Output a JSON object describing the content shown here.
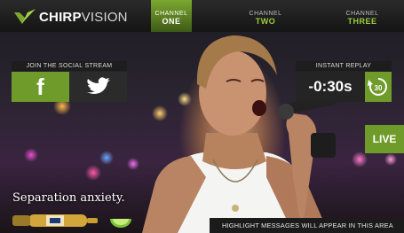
{
  "brand": {
    "name_bold": "CHIRP",
    "name_light": "VISION",
    "accent": "#7ba830"
  },
  "channels": [
    {
      "label": "CHANNEL",
      "name": "ONE",
      "active": true
    },
    {
      "label": "CHANNEL",
      "name": "TWO",
      "active": false
    },
    {
      "label": "CHANNEL",
      "name": "THREE",
      "active": false
    }
  ],
  "social": {
    "title": "JOIN THE SOCIAL STREAM",
    "facebook_icon": "facebook-icon",
    "twitter_icon": "twitter-icon"
  },
  "replay": {
    "title": "INSTANT REPLAY",
    "time": "-0:30s",
    "button_text": "30",
    "button_icon": "rewind-30-icon"
  },
  "live": {
    "label": "LIVE"
  },
  "ad": {
    "tagline": "Separation anxiety."
  },
  "highlight": {
    "message": "HIGHLIGHT MESSAGES WILL APPEAR IN THIS AREA"
  }
}
